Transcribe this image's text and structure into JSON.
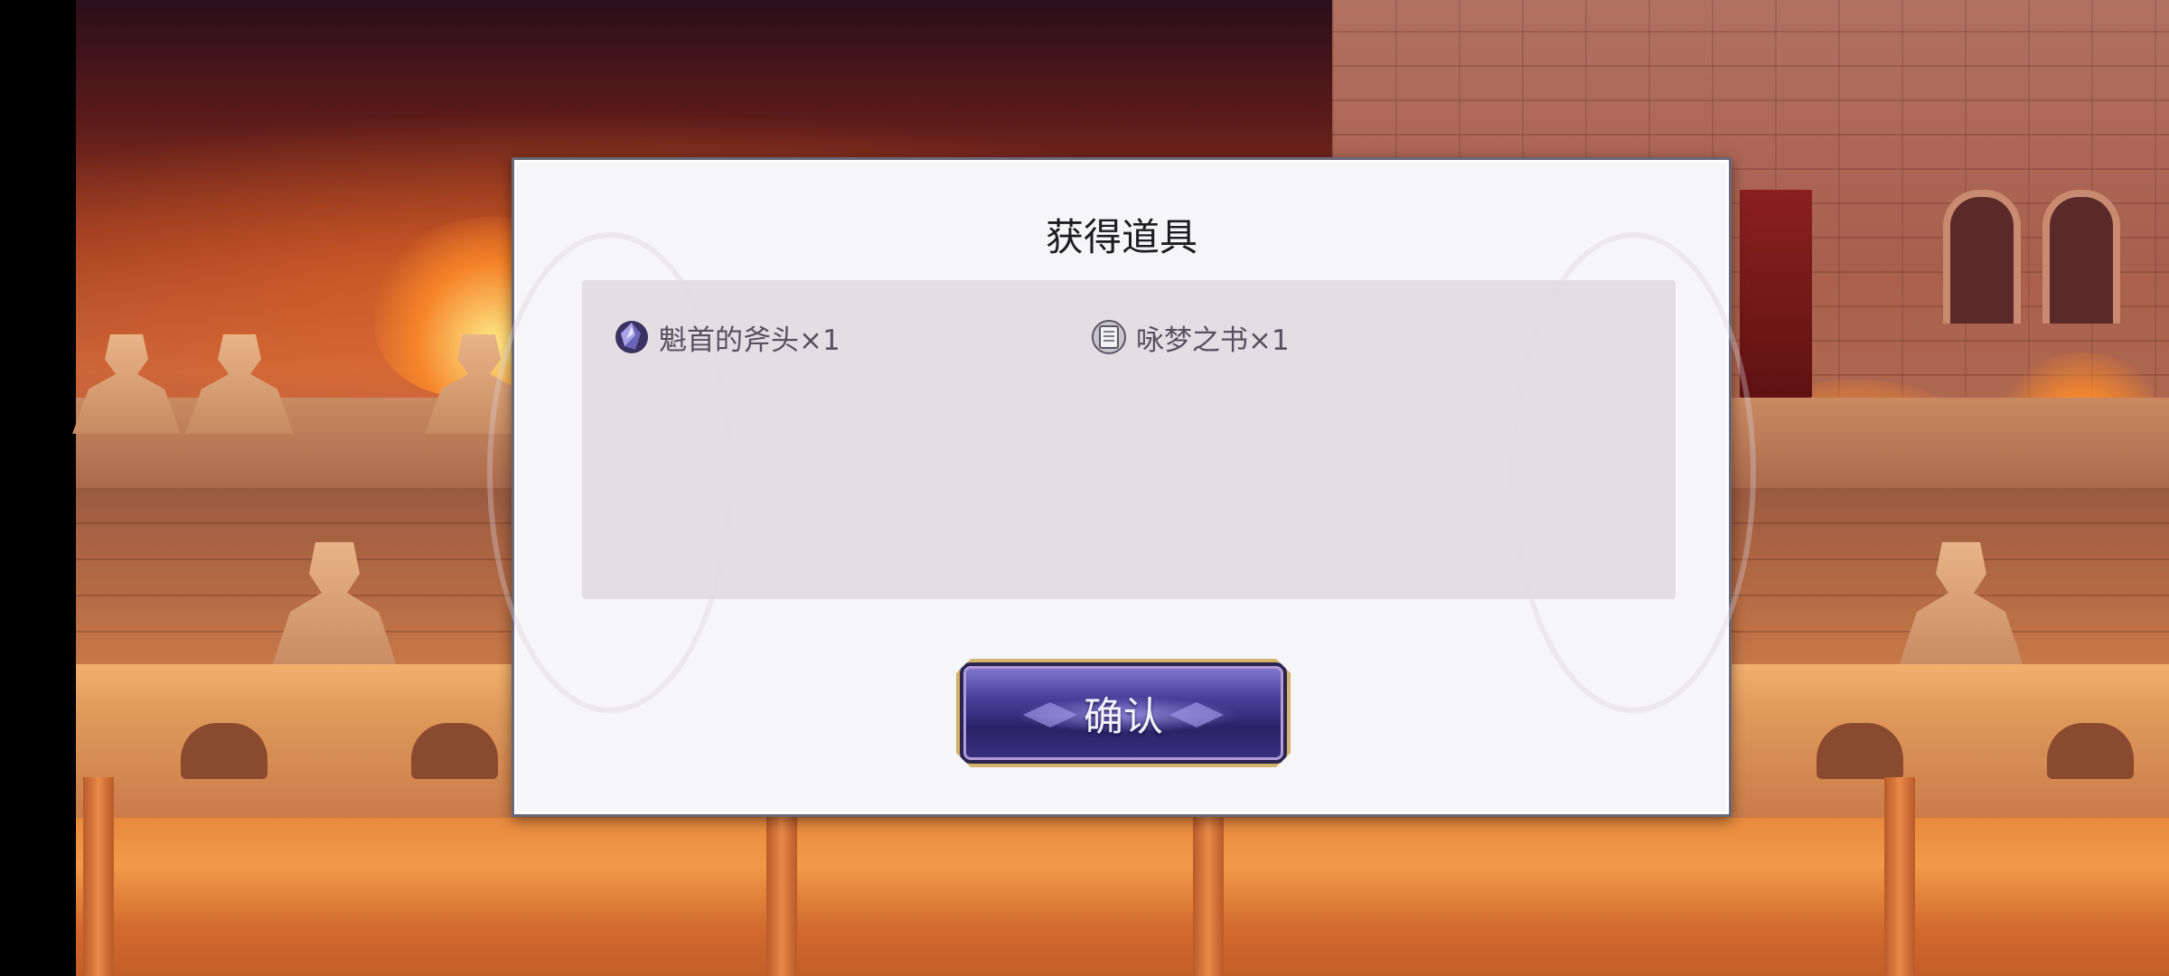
{
  "dialog": {
    "title": "获得道具",
    "items": [
      {
        "label": "魁首的斧头×1",
        "icon": "crystal-axe-icon"
      },
      {
        "label": "咏梦之书×1",
        "icon": "book-icon"
      }
    ],
    "confirm_label": "确认"
  },
  "colors": {
    "dialog_bg": "#f6f5f8",
    "panel_bg": "#e0dce2",
    "button_purple": "#4a3f9a",
    "button_gold_border": "#d2b46a"
  }
}
